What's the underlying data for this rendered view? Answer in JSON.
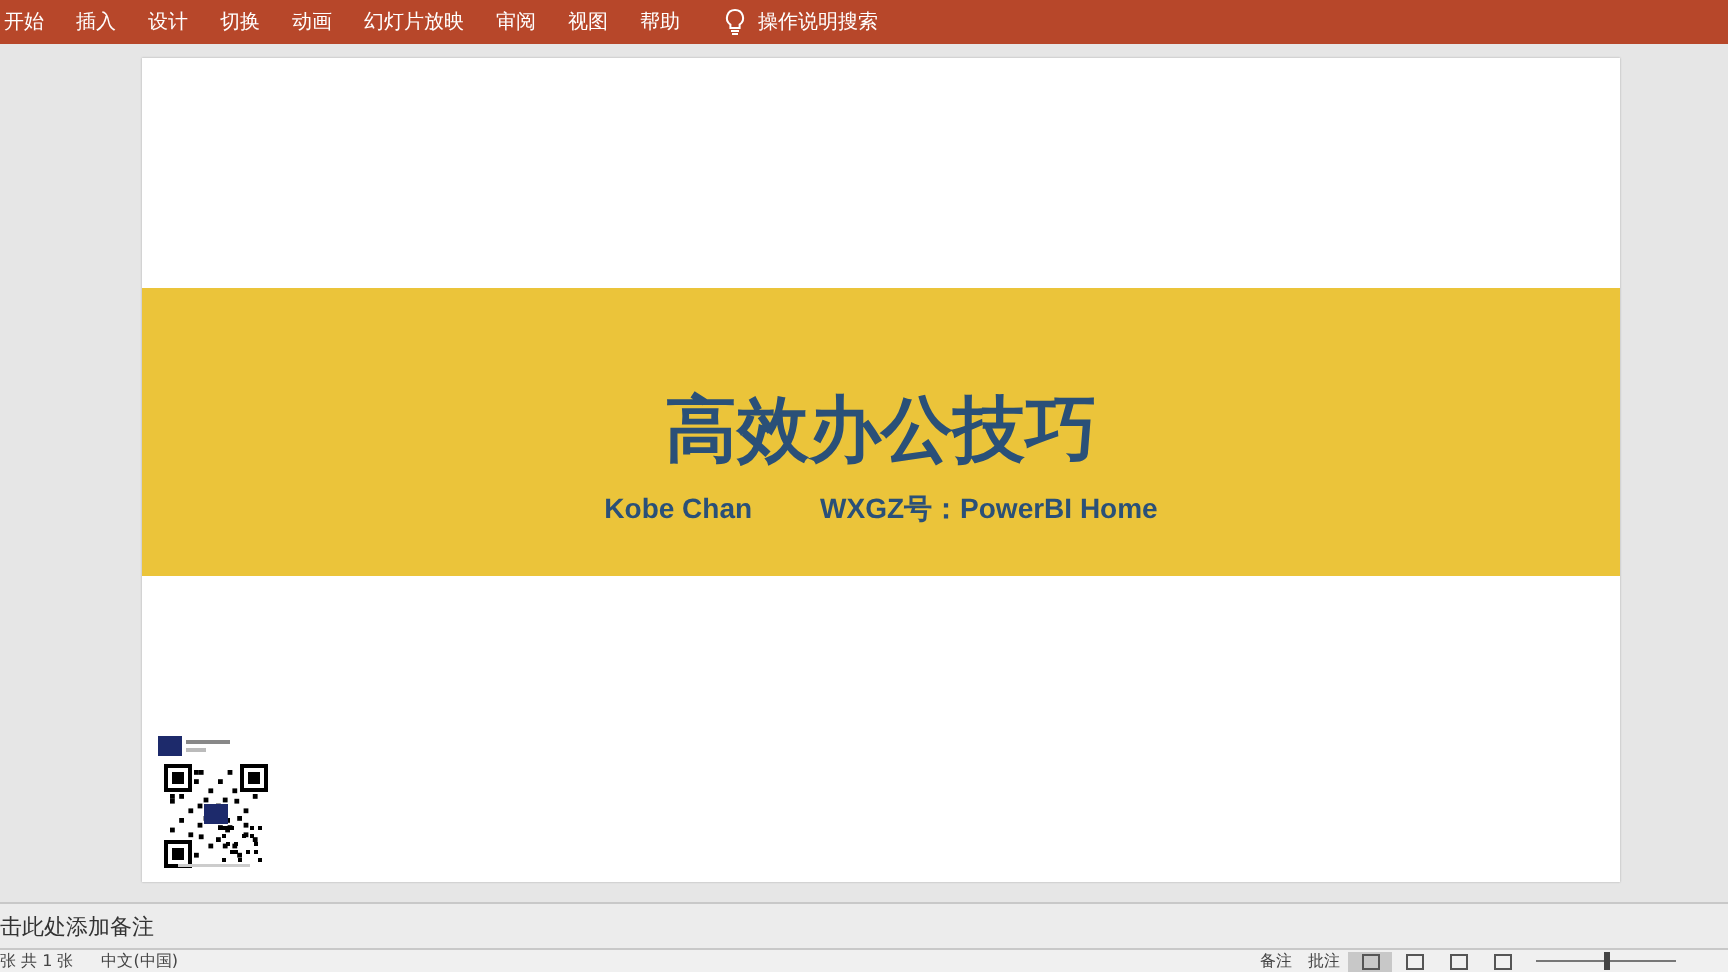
{
  "ribbon": {
    "tabs": [
      {
        "label": "开始",
        "selected": false
      },
      {
        "label": "插入",
        "selected": false
      },
      {
        "label": "设计",
        "selected": false
      },
      {
        "label": "切换",
        "selected": false
      },
      {
        "label": "动画",
        "selected": false
      },
      {
        "label": "幻灯片放映",
        "selected": false
      },
      {
        "label": "审阅",
        "selected": false
      },
      {
        "label": "视图",
        "selected": false
      },
      {
        "label": "帮助",
        "selected": false
      }
    ],
    "search_label": "操作说明搜索"
  },
  "slide": {
    "title": "高效办公技巧",
    "author": "Kobe Chan",
    "account": "WXGZ号：PowerBI Home"
  },
  "notes": {
    "placeholder": "击此处添加备注"
  },
  "status_bar": {
    "slide_count": "张 共 1 张",
    "language": "中文(中国)",
    "notes_button": "备注",
    "comments_button": "批注",
    "views": [
      {
        "selected": true
      },
      {
        "selected": false
      },
      {
        "selected": false
      },
      {
        "selected": false
      }
    ],
    "zoom": {
      "level": 0.5
    }
  }
}
